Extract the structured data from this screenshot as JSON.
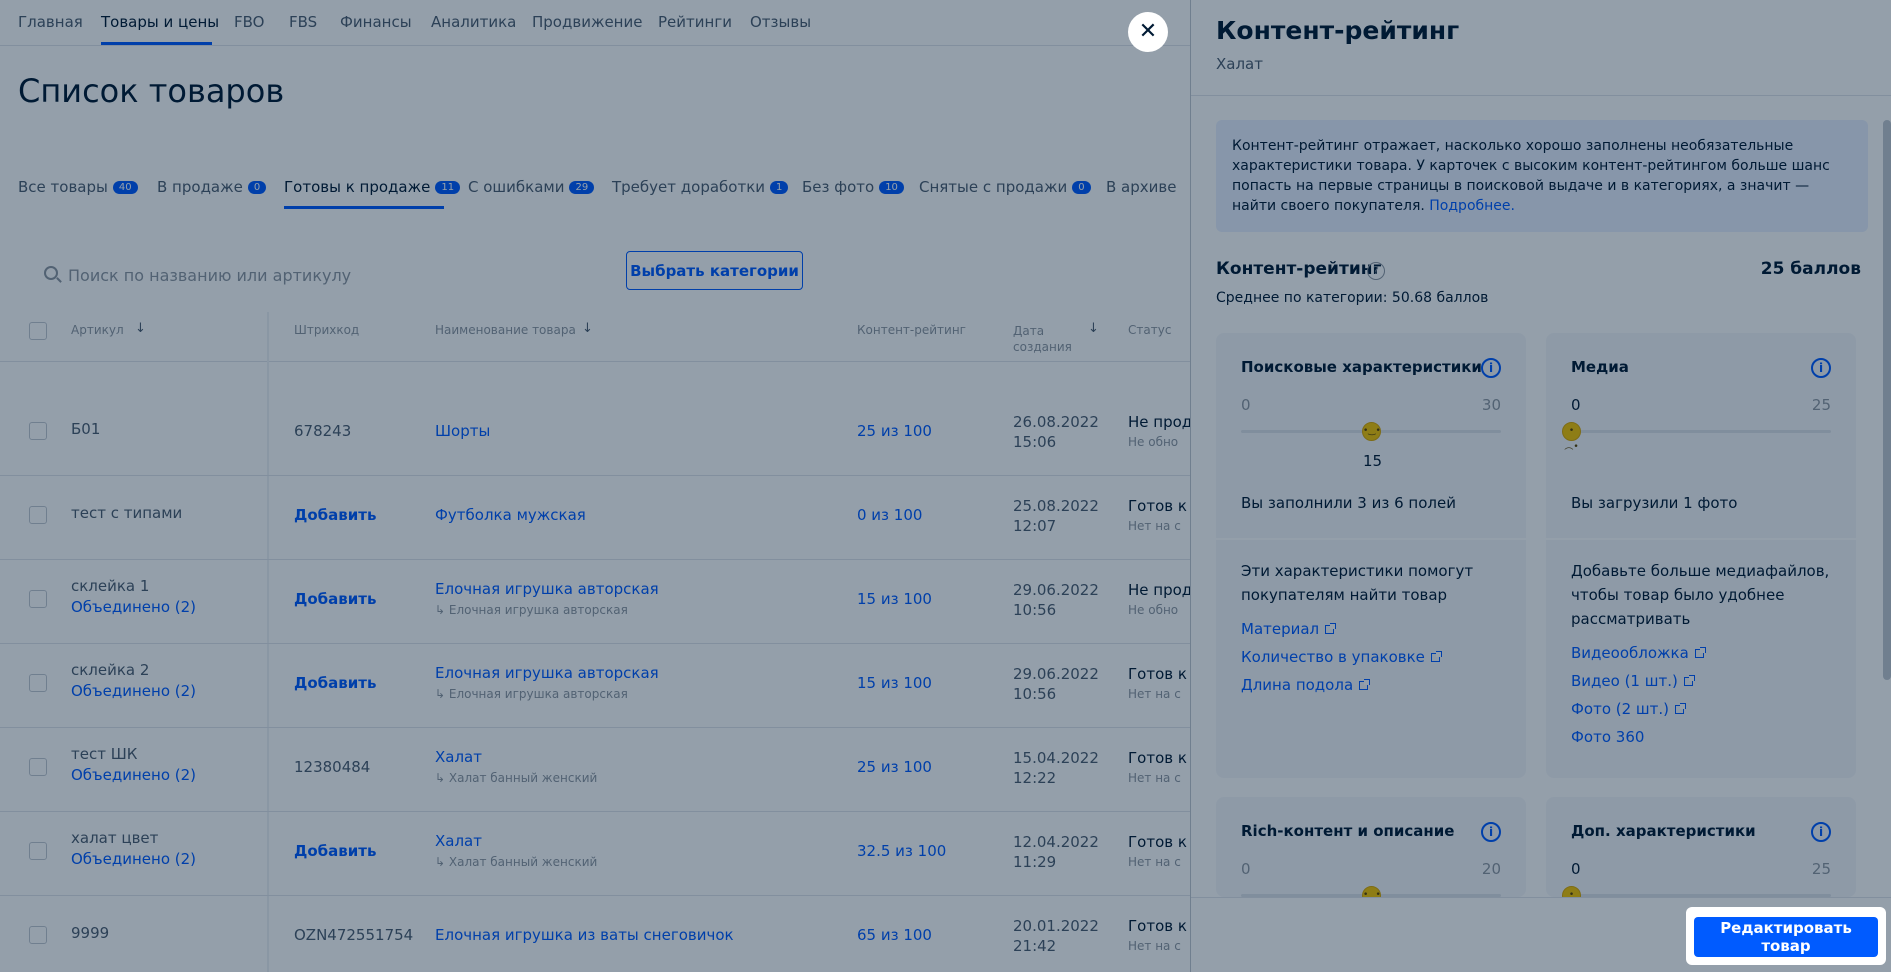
{
  "nav": {
    "items": [
      "Главная",
      "Товары и цены",
      "FBO",
      "FBS",
      "Финансы",
      "Аналитика",
      "Продвижение",
      "Рейтинги",
      "Отзывы"
    ],
    "active": "Товары и цены"
  },
  "page_title": "Список товаров",
  "tabs": [
    {
      "label": "Все товары",
      "count": "40"
    },
    {
      "label": "В продаже",
      "count": "0"
    },
    {
      "label": "Готовы к продаже",
      "count": "11"
    },
    {
      "label": "С ошибками",
      "count": "29"
    },
    {
      "label": "Требует доработки",
      "count": "1"
    },
    {
      "label": "Без фото",
      "count": "10"
    },
    {
      "label": "Снятые с продажи",
      "count": "0"
    },
    {
      "label": "В архиве",
      "count": ""
    }
  ],
  "search": {
    "placeholder": "Поиск по названию или артикулу"
  },
  "choose_category": "Выбрать категории",
  "columns": {
    "article": "Артикул",
    "barcode": "Штрихкод",
    "name": "Наименование товара",
    "rating": "Контент-рейтинг",
    "date": "Дата создания",
    "status": "Статус"
  },
  "rows": [
    {
      "article": "Б01",
      "article_link": "",
      "barcode": "678243",
      "barcode_add": false,
      "name": "Шорты",
      "name_sub": "",
      "rating": "25 из 100",
      "date": "26.08.2022",
      "time": "15:06",
      "status": "Не прод",
      "status_sub": "Не обно"
    },
    {
      "article": "тест с типами",
      "article_link": "",
      "barcode": "Добавить",
      "barcode_add": true,
      "name": "Футболка мужская",
      "name_sub": "",
      "rating": "0 из 100",
      "date": "25.08.2022",
      "time": "12:07",
      "status": "Готов к",
      "status_sub": "Нет на с"
    },
    {
      "article": "склейка 1",
      "article_link": "Объединено (2)",
      "barcode": "Добавить",
      "barcode_add": true,
      "name": "Елочная игрушка авторская",
      "name_sub": "Елочная игрушка авторская",
      "rating": "15 из 100",
      "date": "29.06.2022",
      "time": "10:56",
      "status": "Не прод",
      "status_sub": "Не обно"
    },
    {
      "article": "склейка 2",
      "article_link": "Объединено (2)",
      "barcode": "Добавить",
      "barcode_add": true,
      "name": "Елочная игрушка авторская",
      "name_sub": "Елочная игрушка авторская",
      "rating": "15 из 100",
      "date": "29.06.2022",
      "time": "10:56",
      "status": "Готов к",
      "status_sub": "Нет на с"
    },
    {
      "article": "тест ШК",
      "article_link": "Объединено (2)",
      "barcode": "12380484",
      "barcode_add": false,
      "name": "Халат",
      "name_sub": "Халат банный женский",
      "rating": "25 из 100",
      "date": "15.04.2022",
      "time": "12:22",
      "status": "Готов к",
      "status_sub": "Нет на с"
    },
    {
      "article": "халат цвет",
      "article_link": "Объединено (2)",
      "barcode": "Добавить",
      "barcode_add": true,
      "name": "Халат",
      "name_sub": "Халат банный женский",
      "rating": "32.5 из 100",
      "date": "12.04.2022",
      "time": "11:29",
      "status": "Готов к",
      "status_sub": "Нет на с"
    },
    {
      "article": "9999",
      "article_link": "",
      "barcode": "OZN472551754",
      "barcode_add": false,
      "name": "Елочная игрушка из ваты снеговичок",
      "name_sub": "",
      "rating": "65 из 100",
      "date": "20.01.2022",
      "time": "21:42",
      "status": "Готов к",
      "status_sub": "Нет на с"
    }
  ],
  "drawer": {
    "title": "Контент-рейтинг",
    "subtitle": "Халат",
    "info_text": "Контент-рейтинг отражает, насколько хорошо заполнены необязательные характеристики товара. У карточек с высоким контент-рейтингом больше шанс попасть на первые страницы в поисковой выдаче и в категориях, а значит — найти своего покупателя.",
    "info_link": "Подробнее.",
    "rating_label": "Контент-рейтинг",
    "rating_points": "25 баллов",
    "avg_text": "Среднее по категории: 50.68 баллов",
    "cards": [
      {
        "title": "Поисковые характеристики",
        "min": "0",
        "max": "30",
        "value": "15",
        "fraction": 0.5,
        "filled": "Вы заполнили 3 из 6 полей",
        "desc": "Эти характеристики помогут покупателям найти товар",
        "links": [
          "Материал",
          "Количество в упаковке",
          "Длина подола"
        ]
      },
      {
        "title": "Медиа",
        "min": "0",
        "max": "25",
        "value": "",
        "fraction": 0,
        "filled": "Вы загрузили 1 фото",
        "desc": "Добавьте больше медиафайлов, чтобы товар было удобнее рассматривать",
        "links": [
          "Видеообложка",
          "Видео (1 шт.)",
          "Фото (2 шт.)",
          "Фото 360"
        ]
      },
      {
        "title": "Rich-контент и описание",
        "min": "0",
        "max": "20",
        "fraction": 0.5
      },
      {
        "title": "Доп. характеристики",
        "min": "0",
        "max": "25",
        "fraction": 0
      }
    ],
    "edit_button": "Редактировать товар"
  }
}
